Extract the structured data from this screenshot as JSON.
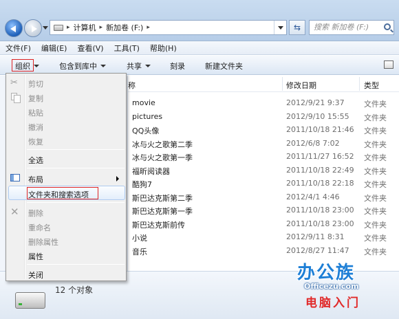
{
  "window": {
    "breadcrumbs": [
      "计算机",
      "新加卷 (F:)"
    ],
    "search_placeholder": "搜索 新加卷 (F:)"
  },
  "menubar": {
    "items": [
      "文件(F)",
      "编辑(E)",
      "查看(V)",
      "工具(T)",
      "帮助(H)"
    ]
  },
  "toolbar": {
    "organize": "组织",
    "include_in_library": "包含到库中",
    "share": "共享",
    "burn": "刻录",
    "new_folder": "新建文件夹"
  },
  "columns": {
    "name": "称",
    "date_modified": "修改日期",
    "type": "类型"
  },
  "files": [
    {
      "name": "movie",
      "date": "2012/9/21 9:37",
      "type": "文件夹"
    },
    {
      "name": "pictures",
      "date": "2012/9/10 15:55",
      "type": "文件夹"
    },
    {
      "name": "QQ头像",
      "date": "2011/10/18 21:46",
      "type": "文件夹"
    },
    {
      "name": "冰与火之歌第二季",
      "date": "2012/6/8 7:02",
      "type": "文件夹"
    },
    {
      "name": "冰与火之歌第一季",
      "date": "2011/11/27 16:52",
      "type": "文件夹"
    },
    {
      "name": "福昕阅读器",
      "date": "2011/10/18 22:49",
      "type": "文件夹"
    },
    {
      "name": "酷狗7",
      "date": "2011/10/18 22:18",
      "type": "文件夹"
    },
    {
      "name": "斯巴达克斯第二季",
      "date": "2012/4/1 4:46",
      "type": "文件夹"
    },
    {
      "name": "斯巴达克斯第一季",
      "date": "2011/10/18 23:00",
      "type": "文件夹"
    },
    {
      "name": "斯巴达克斯前传",
      "date": "2011/10/18 23:00",
      "type": "文件夹"
    },
    {
      "name": "小说",
      "date": "2012/9/11 8:31",
      "type": "文件夹"
    },
    {
      "name": "音乐",
      "date": "2012/8/27 11:47",
      "type": "文件夹"
    }
  ],
  "menu": {
    "cut": "剪切",
    "copy": "复制",
    "paste": "粘贴",
    "undo": "撤消",
    "redo": "恢复",
    "select_all": "全选",
    "layout": "布局",
    "folder_options": "文件夹和搜索选项",
    "delete": "删除",
    "rename": "重命名",
    "remove_properties": "删除属性",
    "properties": "属性",
    "close": "关闭"
  },
  "details": {
    "count": "12 个对象"
  },
  "watermark": {
    "brand": "办公族",
    "url": "Officezu.com",
    "tagline": "电脑入门"
  },
  "colors": {
    "highlight_border": "#dd2222",
    "accent": "#1e7fd6"
  }
}
